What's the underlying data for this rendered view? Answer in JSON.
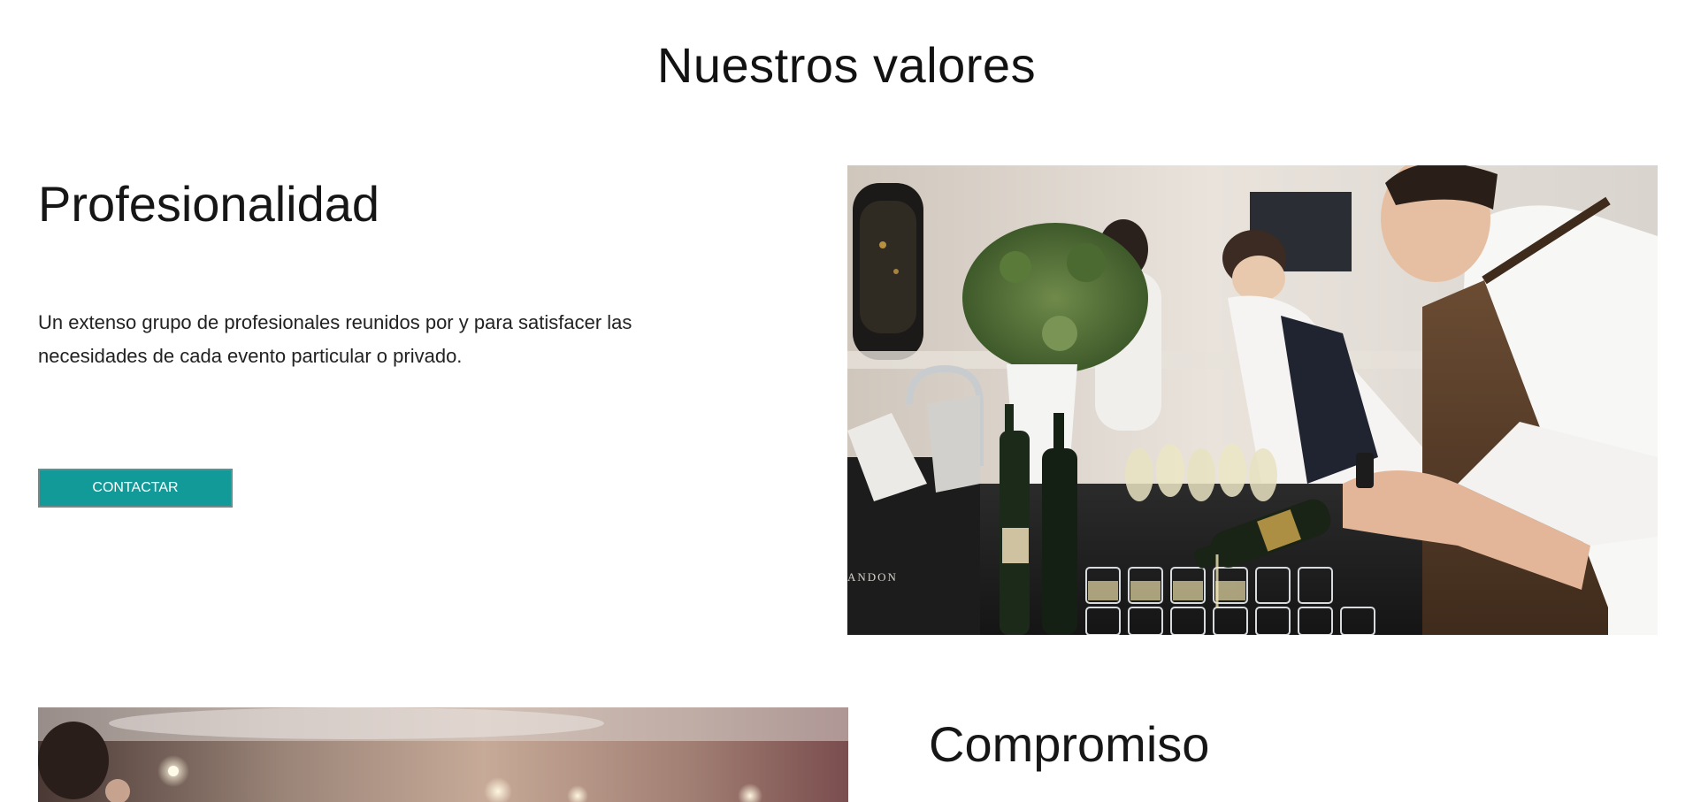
{
  "header": {
    "title": "Nuestros valores"
  },
  "values": [
    {
      "title": "Profesionalidad",
      "description": "Un extenso grupo de profesionales reunidos por y para satisfacer las necesidades de cada evento particular o privado.",
      "button_label": "CONTACTAR"
    },
    {
      "title": "Compromiso"
    }
  ],
  "images": {
    "catering": {
      "description": "waiter in apron pouring champagne into glasses at an event bar",
      "bottle_label": "ANDON"
    },
    "event": {
      "description": "warm blurred event interior with pendant lights"
    }
  },
  "colors": {
    "accent": "#129a99",
    "button_border": "#6f8a8a",
    "text": "#111111",
    "background": "#ffffff"
  }
}
